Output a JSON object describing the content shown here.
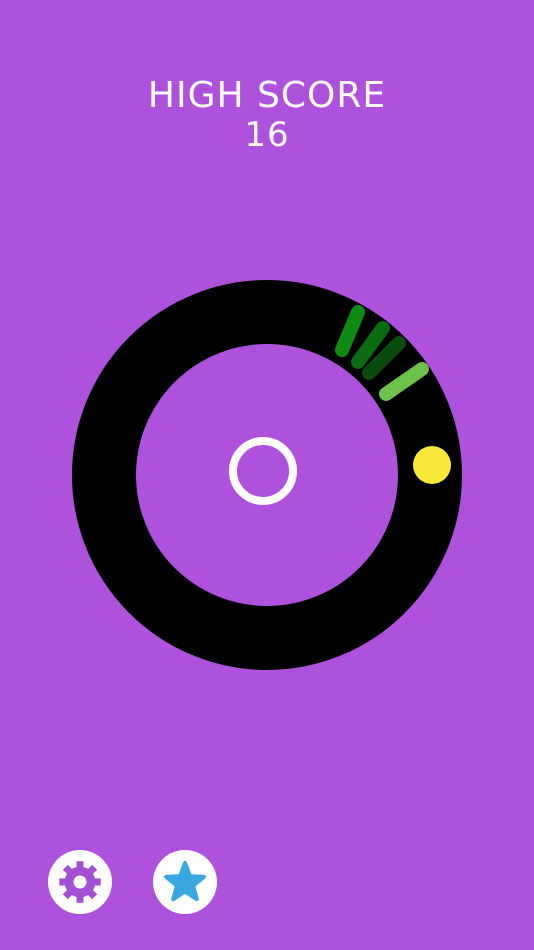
{
  "colors": {
    "background": "#AE52DE",
    "ring": "#000000",
    "player_ball": "#FBE93A",
    "center_ring": "#FFFFFF",
    "button_bg": "#FFFFFF",
    "settings_icon": "#A24FD4",
    "star_icon": "#3AA8E0",
    "segments": [
      "#0C8A12",
      "#0A6C10",
      "#0A4A0E",
      "#6CC24A"
    ]
  },
  "score": {
    "label": "HIGH SCORE",
    "value": "16"
  },
  "buttons": {
    "settings_icon": "gear-icon",
    "rate_icon": "star-icon"
  }
}
